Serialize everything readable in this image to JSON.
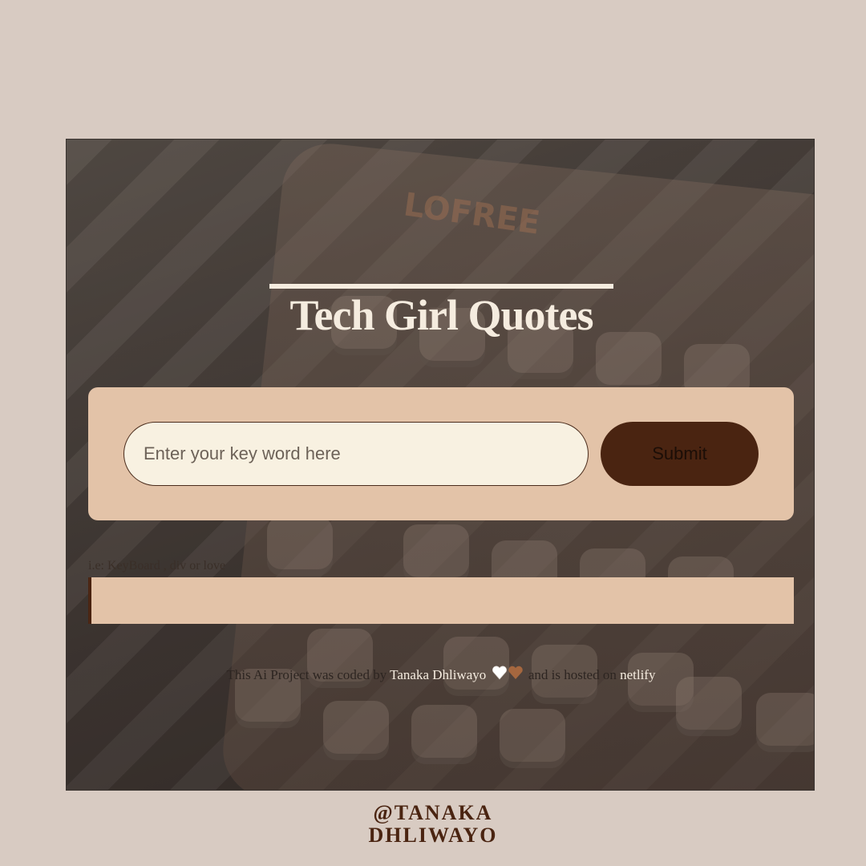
{
  "app": {
    "title": "Tech Girl Quotes"
  },
  "search": {
    "placeholder": "Enter your key word here",
    "submit_label": "Submit",
    "hint": "i.e: KeyBoard , div or love"
  },
  "result": {
    "text": ""
  },
  "footer": {
    "prefix": "This Ai Project was coded by",
    "author": "Tanaka Dhliwayo",
    "middle": "and is hosted on",
    "host": "netlify"
  },
  "handle": {
    "line1": "@TANAKA",
    "line2": "DHLIWAYO"
  },
  "colors": {
    "page_bg": "#d8cbc2",
    "card_bg": "#e3c3a8",
    "input_bg": "#f8f1e1",
    "button_bg": "#4a2411",
    "title_text": "#f5ecdf",
    "brand_brown": "#4a2411"
  }
}
